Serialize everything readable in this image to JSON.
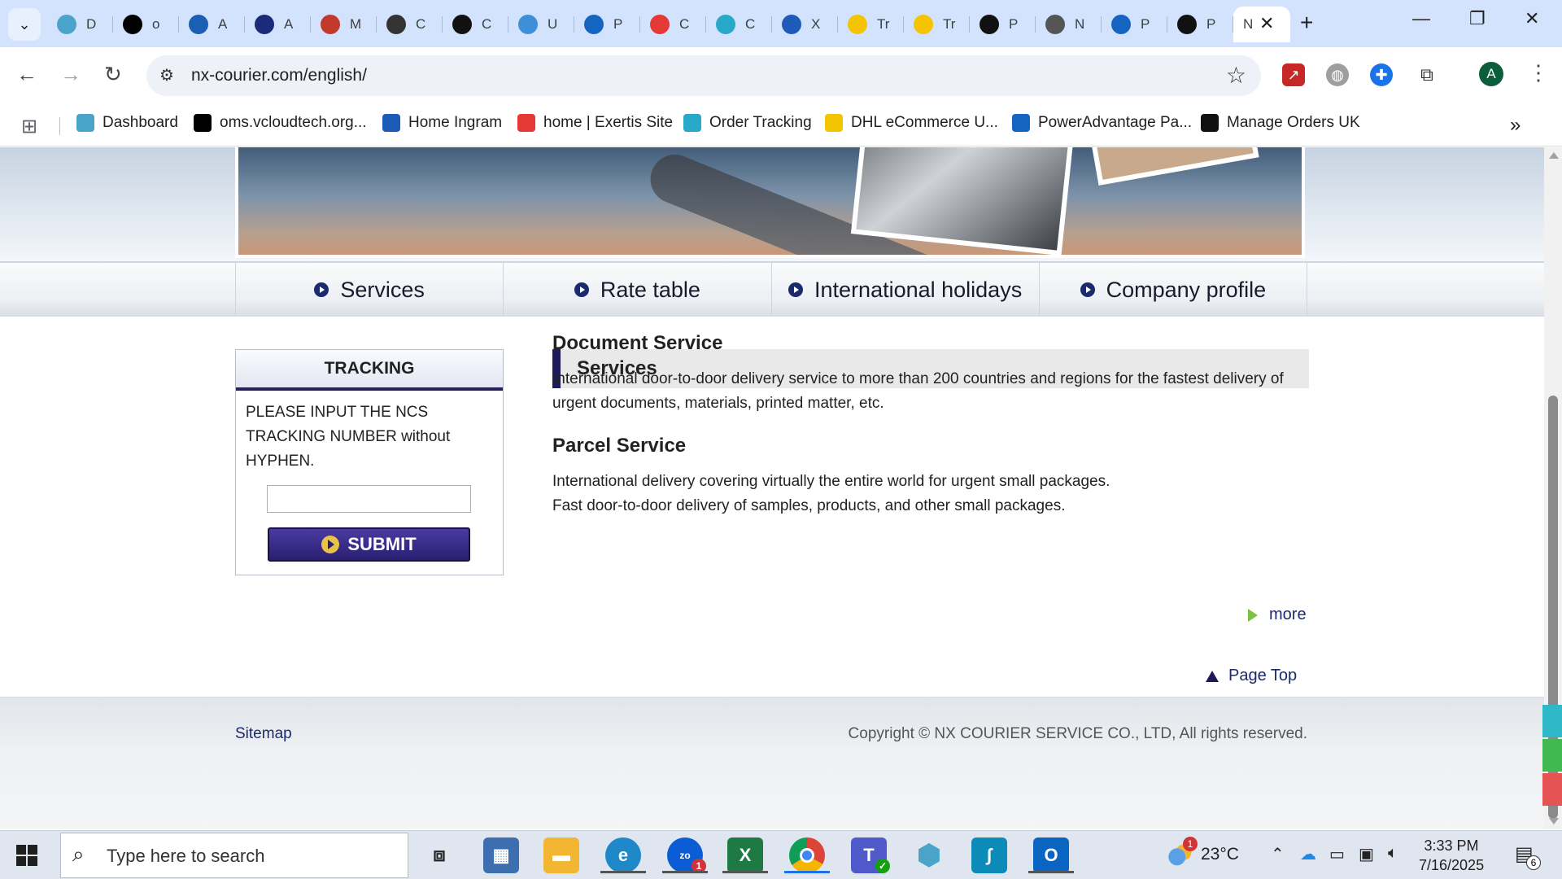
{
  "browser": {
    "tabs": [
      {
        "title": "D",
        "icon": "hexagon-icon",
        "color": "#4aa3c8"
      },
      {
        "title": "o",
        "icon": "triangle-logo-icon",
        "color": "#000000"
      },
      {
        "title": "A",
        "icon": "circle-arc-icon",
        "color": "#1a5fb4"
      },
      {
        "title": "A",
        "icon": "arrow-logo-icon",
        "color": "#1c2a7a"
      },
      {
        "title": "M",
        "icon": "rings-icon",
        "color": "#c0392b"
      },
      {
        "title": "C",
        "icon": "openai-icon",
        "color": "#333333"
      },
      {
        "title": "C",
        "icon": "openai-icon",
        "color": "#111111"
      },
      {
        "title": "U",
        "icon": "globe-icon",
        "color": "#3d8fd8"
      },
      {
        "title": "P",
        "icon": "e-logo-icon",
        "color": "#1565c0"
      },
      {
        "title": "C",
        "icon": "ex-logo-icon",
        "color": "#e53935"
      },
      {
        "title": "C",
        "icon": "c-logo-icon",
        "color": "#29a9c9"
      },
      {
        "title": "X",
        "icon": "ingram-icon",
        "color": "#1e5bb8"
      },
      {
        "title": "Tr",
        "icon": "dhl-icon",
        "color": "#f5c400"
      },
      {
        "title": "Tr",
        "icon": "dhl-icon",
        "color": "#f5c400"
      },
      {
        "title": "P",
        "icon": "bird-icon",
        "color": "#111111"
      },
      {
        "title": "N",
        "icon": "chrome-grey-icon",
        "color": "#555555"
      },
      {
        "title": "P",
        "icon": "e-logo-icon",
        "color": "#1565c0"
      },
      {
        "title": "P",
        "icon": "bird-icon",
        "color": "#111111"
      },
      {
        "title": "N",
        "icon": "blank-icon",
        "color": "#ffffff"
      }
    ],
    "url": "nx-courier.com/english/",
    "profile_initial": "A"
  },
  "bookmarks": [
    {
      "label": "Dashboard",
      "icon": "hexagon-icon",
      "color": "#4aa3c8"
    },
    {
      "label": "oms.vcloudtech.org...",
      "icon": "triangle-logo-icon",
      "color": "#000000"
    },
    {
      "label": "Home Ingram",
      "icon": "ingram-icon",
      "color": "#1e5bb8"
    },
    {
      "label": "home | Exertis Site",
      "icon": "ex-logo-icon",
      "color": "#e53935"
    },
    {
      "label": "Order Tracking",
      "icon": "c-logo-icon",
      "color": "#29a9c9"
    },
    {
      "label": "DHL eCommerce U...",
      "icon": "dhl-icon",
      "color": "#f5c400"
    },
    {
      "label": "PowerAdvantage Pa...",
      "icon": "doc-icon",
      "color": "#1565c0"
    },
    {
      "label": "Manage Orders UK",
      "icon": "amazon-icon",
      "color": "#111111"
    }
  ],
  "site": {
    "nav": [
      "Services",
      "Rate table",
      "International holidays",
      "Company profile"
    ],
    "tracking": {
      "title": "TRACKING",
      "instructions": "PLEASE INPUT THE NCS TRACKING NUMBER without HYPHEN.",
      "input_value": "",
      "submit_label": "SUBMIT"
    },
    "services": {
      "heading": "Services",
      "document_title": "Document Service",
      "document_text": "International door-to-door delivery service to more than 200 countries and regions for the fastest delivery of urgent documents, materials, printed matter, etc.",
      "parcel_title": "Parcel Service",
      "parcel_text_1": "International delivery covering virtually the entire world for urgent small packages.",
      "parcel_text_2": "Fast door-to-door delivery of samples, products, and other small packages.",
      "more_label": "more"
    },
    "page_top_label": "Page Top",
    "footer": {
      "sitemap": "Sitemap",
      "copyright": "Copyright © NX  COURIER SERVICE CO., LTD, All rights reserved."
    },
    "accent_color": "#1c1a5a"
  },
  "taskbar": {
    "search_placeholder": "Type here to search",
    "teams_badge": "1",
    "weather_badge": "1",
    "temperature": "23°C",
    "time": "3:33 PM",
    "date": "7/16/2025",
    "notification_count": "6"
  }
}
